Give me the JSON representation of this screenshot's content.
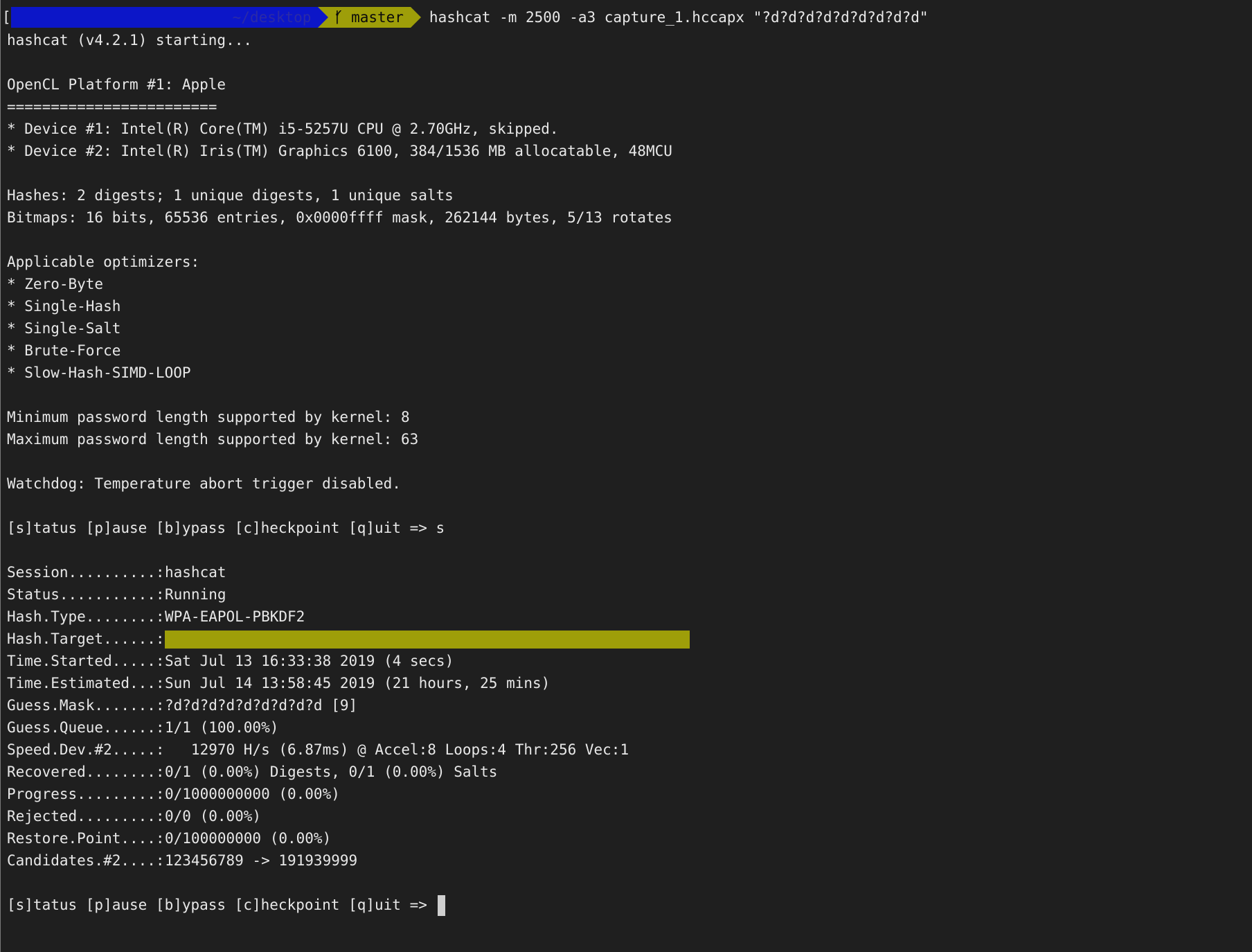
{
  "prompt": {
    "bracket": "[",
    "path": "~/desktop",
    "branch": "master",
    "command": "hashcat -m 2500 -a3 capture_1.hccapx \"?d?d?d?d?d?d?d?d?d\""
  },
  "header": {
    "starting": "hashcat (v4.2.1) starting...",
    "platform": "OpenCL Platform #1: Apple",
    "rule": "========================",
    "device1": "* Device #1: Intel(R) Core(TM) i5-5257U CPU @ 2.70GHz, skipped.",
    "device2": "* Device #2: Intel(R) Iris(TM) Graphics 6100, 384/1536 MB allocatable, 48MCU",
    "hashes": "Hashes: 2 digests; 1 unique digests, 1 unique salts",
    "bitmaps": "Bitmaps: 16 bits, 65536 entries, 0x0000ffff mask, 262144 bytes, 5/13 rotates",
    "optimizers_title": "Applicable optimizers:",
    "optimizers": [
      "* Zero-Byte",
      "* Single-Hash",
      "* Single-Salt",
      "* Brute-Force",
      "* Slow-Hash-SIMD-LOOP"
    ],
    "min_len": "Minimum password length supported by kernel: 8",
    "max_len": "Maximum password length supported by kernel: 63",
    "watchdog": "Watchdog: Temperature abort trigger disabled.",
    "menu1": "[s]tatus [p]ause [b]ypass [c]heckpoint [q]uit => s"
  },
  "status": [
    {
      "key": "Session..........:",
      "value": "hashcat"
    },
    {
      "key": "Status...........:",
      "value": "Running"
    },
    {
      "key": "Hash.Type........:",
      "value": "WPA-EAPOL-PBKDF2"
    },
    {
      "key": "Hash.Target......:",
      "value": ""
    },
    {
      "key": "Time.Started.....:",
      "value": "Sat Jul 13 16:33:38 2019 (4 secs)"
    },
    {
      "key": "Time.Estimated...:",
      "value": "Sun Jul 14 13:58:45 2019 (21 hours, 25 mins)"
    },
    {
      "key": "Guess.Mask.......:",
      "value": "?d?d?d?d?d?d?d?d?d [9]"
    },
    {
      "key": "Guess.Queue......:",
      "value": "1/1 (100.00%)"
    },
    {
      "key": "Speed.Dev.#2.....:",
      "value": "   12970 H/s (6.87ms) @ Accel:8 Loops:4 Thr:256 Vec:1"
    },
    {
      "key": "Recovered........:",
      "value": "0/1 (0.00%) Digests, 0/1 (0.00%) Salts"
    },
    {
      "key": "Progress.........:",
      "value": "0/1000000000 (0.00%)"
    },
    {
      "key": "Rejected.........:",
      "value": "0/0 (0.00%)"
    },
    {
      "key": "Restore.Point....:",
      "value": "0/100000000 (0.00%)"
    },
    {
      "key": "Candidates.#2....:",
      "value": "123456789 -> 191939999"
    }
  ],
  "menu2": "[s]tatus [p]ause [b]ypass [c]heckpoint [q]uit => ",
  "colors": {
    "background": "#1f1f1f",
    "segment_blue": "#0c16c8",
    "segment_olive": "#9e9e09",
    "text": "#e8e8e8"
  }
}
